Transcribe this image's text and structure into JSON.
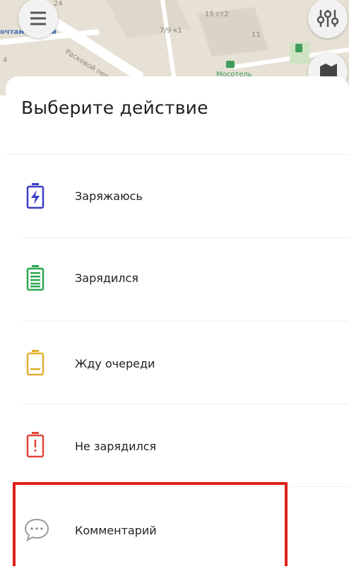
{
  "map": {
    "labels": {
      "pochtamt": "очтамт",
      "post_tail": "ии",
      "street": "Расковой пер.",
      "building_24": "24",
      "building_15": "15 ст2",
      "building_7": "7/9 к1",
      "building_11": "11",
      "building_4": "4",
      "hotel": "Мосотель"
    },
    "menu_icon": "hamburger-menu-icon",
    "filter_icon": "filter-sliders-icon",
    "layers_icon": "map-layers-icon"
  },
  "sheet": {
    "title": "Выберите действие",
    "items": [
      {
        "label": "Заряжаюсь",
        "icon": "battery-charging-icon",
        "color": "#3b3fc6"
      },
      {
        "label": "Зарядился",
        "icon": "battery-full-icon",
        "color": "#2ea84f"
      },
      {
        "label": "Жду очереди",
        "icon": "battery-low-icon",
        "color": "#e0b030"
      },
      {
        "label": "Не зарядился",
        "icon": "battery-alert-icon",
        "color": "#e0453c"
      },
      {
        "label": "Комментарий",
        "icon": "comment-icon",
        "color": "#9a9a9a"
      }
    ]
  },
  "highlight_color": "#e0201c"
}
